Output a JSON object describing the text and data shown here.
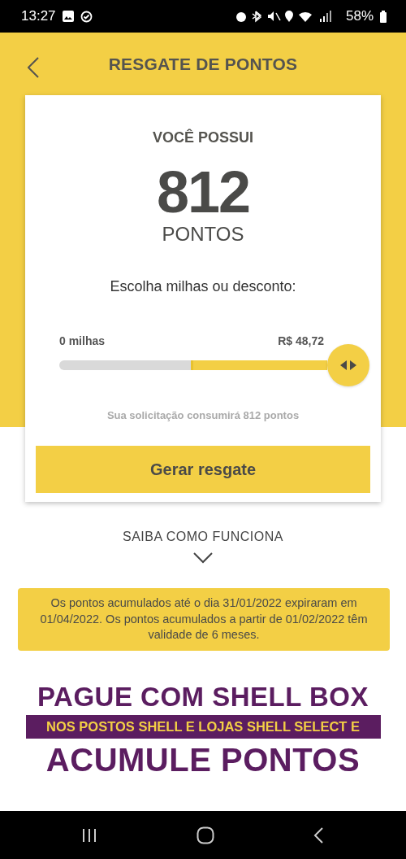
{
  "status_bar": {
    "time": "13:27",
    "battery": "58%"
  },
  "header": {
    "title": "RESGATE DE PONTOS"
  },
  "card": {
    "heading": "VOCÊ POSSUI",
    "points": "812",
    "points_unit": "PONTOS",
    "prompt": "Escolha milhas ou desconto:",
    "slider": {
      "min_label": "0 milhas",
      "max_label": "R$ 48,72"
    },
    "note": "Sua solicitação consumirá 812 pontos",
    "button": "Gerar resgate"
  },
  "how_it_works": {
    "label": "SAIBA COMO FUNCIONA"
  },
  "notice": "Os pontos acumulados até o dia 31/01/2022 expiraram em 01/04/2022. Os pontos acumulados a partir de 01/02/2022 têm validade de 6 meses.",
  "banner": {
    "line_1": "PAGUE COM SHELL BOX",
    "line_2": "NOS POSTOS SHELL E LOJAS SHELL SELECT E",
    "line_3": "ACUMULE PONTOS"
  }
}
